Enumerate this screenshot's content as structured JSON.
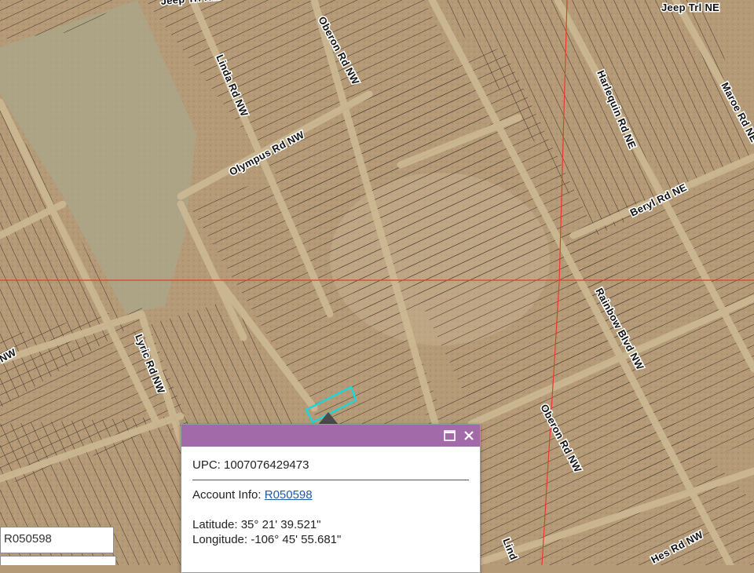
{
  "map": {
    "road_labels": [
      "Jeep Trl NW",
      "Jeep Trl NE",
      "Linda Rd NW",
      "Oberon Rd NW",
      "Harlequin Rd NE",
      "Maroe Rd NE",
      "Olympus Rd NW",
      "Beryl Rd NE",
      "Rainbow Blvd NW",
      "Lyric Rd NW",
      "Oberon Rd NW",
      "NW",
      "Lind",
      "Hes Rd NW"
    ],
    "colors": {
      "terrain": "#b59a78",
      "terrain_light": "#c8b08c",
      "terrain_green": "#9da286",
      "parcel_line": "#2a2218",
      "road": "#cdb994",
      "section_line": "#e83a2a",
      "selected_parcel": "#1fd5d8"
    }
  },
  "popup": {
    "header_color": "#a26aa8",
    "maximize_icon": "maximize-icon",
    "close_icon": "close-icon",
    "upc_text": "UPC: 1007076429473",
    "account_label": "Account Info: ",
    "account_link": "R050598",
    "latitude_text": "Latitude: 35° 21' 39.521\"",
    "longitude_text": "Longitude: -106° 45' 55.681\""
  },
  "search": {
    "parcel_value": "R050598"
  }
}
